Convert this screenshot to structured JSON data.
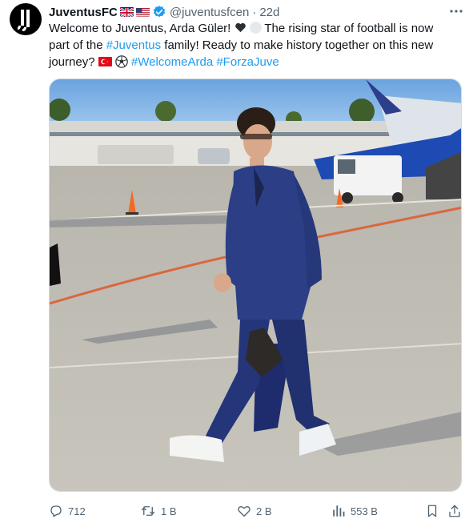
{
  "account": {
    "name": "JuventusFC",
    "handle": "@juventusfcen",
    "separator": "·",
    "time": "22d"
  },
  "tweet": {
    "line1_a": "Welcome to Juventus, Arda Güler! ",
    "line1_b": " The rising star of football is now",
    "line2_a": "part of the ",
    "hashtag_juventus": "#Juventus",
    "line2_b": " family! Ready to make history together on this new",
    "line3_a": "journey? ",
    "hashtag_welcome": "#WelcomeArda",
    "hashtag_forza": "#ForzaJuve"
  },
  "actions": {
    "replies": "712",
    "reposts": "1 B",
    "likes": "2 B",
    "views": "553 B"
  },
  "colors": {
    "link": "#1d9bf0",
    "muted": "#536471",
    "verified": "#1d9bf0"
  },
  "icons": [
    "juventus-logo-icon",
    "uk-flag-icon",
    "us-flag-icon",
    "verified-badge-icon",
    "more-icon",
    "black-heart-emoji",
    "white-circle-emoji",
    "turkey-flag-emoji",
    "soccer-ball-emoji",
    "reply-icon",
    "repost-icon",
    "like-icon",
    "views-icon",
    "bookmark-icon",
    "share-icon"
  ]
}
